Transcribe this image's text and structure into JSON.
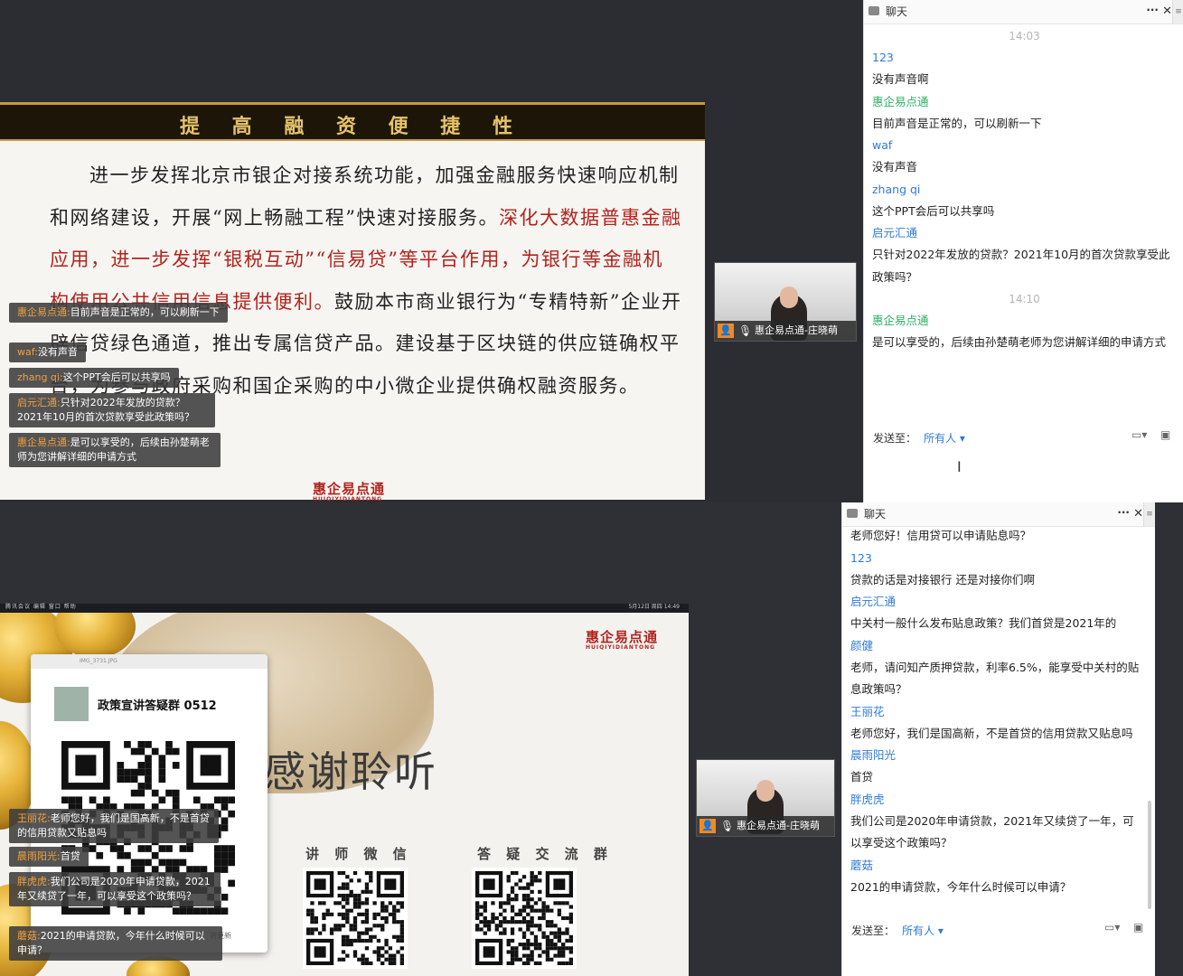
{
  "top": {
    "slide": {
      "title": "提 高 融 资 便 捷 性",
      "para_black_1": "进一步发挥北京市银企对接系统功能，加强金融服务快速响应机制和网络建设，开展“网上畅融工程”快速对接服务。",
      "para_red": "深化大数据普惠金融应用，进一步发挥“银税互动”“信易贷”等平台作用，为银行等金融机构使用公共信用信息提供便利。",
      "para_black_2": "鼓励本市商业银行为“专精特新”企业开辟信贷绿色通道，推出专属信贷产品。建设基于区块链的供应链确权平台，为参与政府采购和国企采购的中小微企业提供确权融资服务。",
      "logo": "惠企易点通",
      "logo_pinyin": "HUIQIYIDIANTONG"
    },
    "overlay": [
      {
        "name": "惠企易点通:",
        "text": "目前声音是正常的，可以刷新一下"
      },
      {
        "name": "waf:",
        "text": "没有声音"
      },
      {
        "name": "zhang qi:",
        "text": "这个PPT会后可以共享吗"
      },
      {
        "name": "启元汇通:",
        "text": "只针对2022年发放的贷款？2021年10月的首次贷款享受此政策吗？"
      },
      {
        "name": "惠企易点通:",
        "text": "是可以享受的，后续由孙楚萌老师为您讲解详细的申请方式"
      }
    ],
    "cam_label": "惠企易点通-庄晓萌",
    "chat": {
      "title": "聊天",
      "messages": [
        {
          "time": "14:03"
        },
        {
          "sender": "123",
          "text": "没有声音啊"
        },
        {
          "sender": "惠企易点通",
          "host": true,
          "text": "目前声音是正常的，可以刷新一下"
        },
        {
          "sender": "waf",
          "text": "没有声音"
        },
        {
          "sender": "zhang qi",
          "text": "这个PPT会后可以共享吗"
        },
        {
          "sender": "启元汇通",
          "text": "只针对2022年发放的贷款？2021年10月的首次贷款享受此政策吗？"
        },
        {
          "time": "14:10"
        },
        {
          "sender": "惠企易点通",
          "host": true,
          "text": "是可以享受的，后续由孙楚萌老师为您讲解详细的申请方式"
        }
      ],
      "send_label": "发送至：",
      "send_to": "所有人 ▾"
    }
  },
  "bottom": {
    "menubar_left": "腾讯会议  编辑  窗口  帮助",
    "menubar_right": "5月12日 周四 14:49",
    "slide": {
      "logo": "惠企易点通",
      "logo_pinyin": "HUIQIYIDIANTONG",
      "thanks": "感谢聆听",
      "window_title": "IMG_3731.JPG",
      "group_name": "政策宣讲答疑群 0512",
      "label_teacher": "讲 师 微 信",
      "label_group": "答 疑 交 流 群",
      "hint": "将更新"
    },
    "overlay": [
      {
        "name": "王丽花:",
        "text": "老师您好，我们是国高新，不是首贷的信用贷款又贴息吗"
      },
      {
        "name": "晨雨阳光:",
        "text": "首贷"
      },
      {
        "name": "胖虎虎:",
        "text": "我们公司是2020年申请贷款，2021年又续贷了一年，可以享受这个政策吗？"
      },
      {
        "name": "蘑菇:",
        "text": "2021的申请贷款，今年什么时候可以申请？"
      }
    ],
    "cam_label": "惠企易点通-庄晓萌",
    "chat": {
      "title": "聊天",
      "messages": [
        {
          "text": "老师您好！信用贷可以申请贴息吗？"
        },
        {
          "sender": "123",
          "text": "贷款的话是对接银行 还是对接你们啊"
        },
        {
          "sender": "启元汇通",
          "text": "中关村一般什么发布贴息政策？我们首贷是2021年的"
        },
        {
          "sender": "颜健",
          "text": "老师，请问知产质押贷款，利率6.5%，能享受中关村的贴息政策吗？"
        },
        {
          "sender": "王丽花",
          "text": "老师您好，我们是国高新，不是首贷的信用贷款又贴息吗"
        },
        {
          "sender": "晨雨阳光",
          "text": "首贷"
        },
        {
          "sender": "胖虎虎",
          "text": "我们公司是2020年申请贷款，2021年又续贷了一年，可以享受这个政策吗？"
        },
        {
          "sender": "蘑菇",
          "text": "2021的申请贷款，今年什么时候可以申请？"
        }
      ],
      "send_label": "发送至：",
      "send_to": "所有人 ▾"
    }
  }
}
